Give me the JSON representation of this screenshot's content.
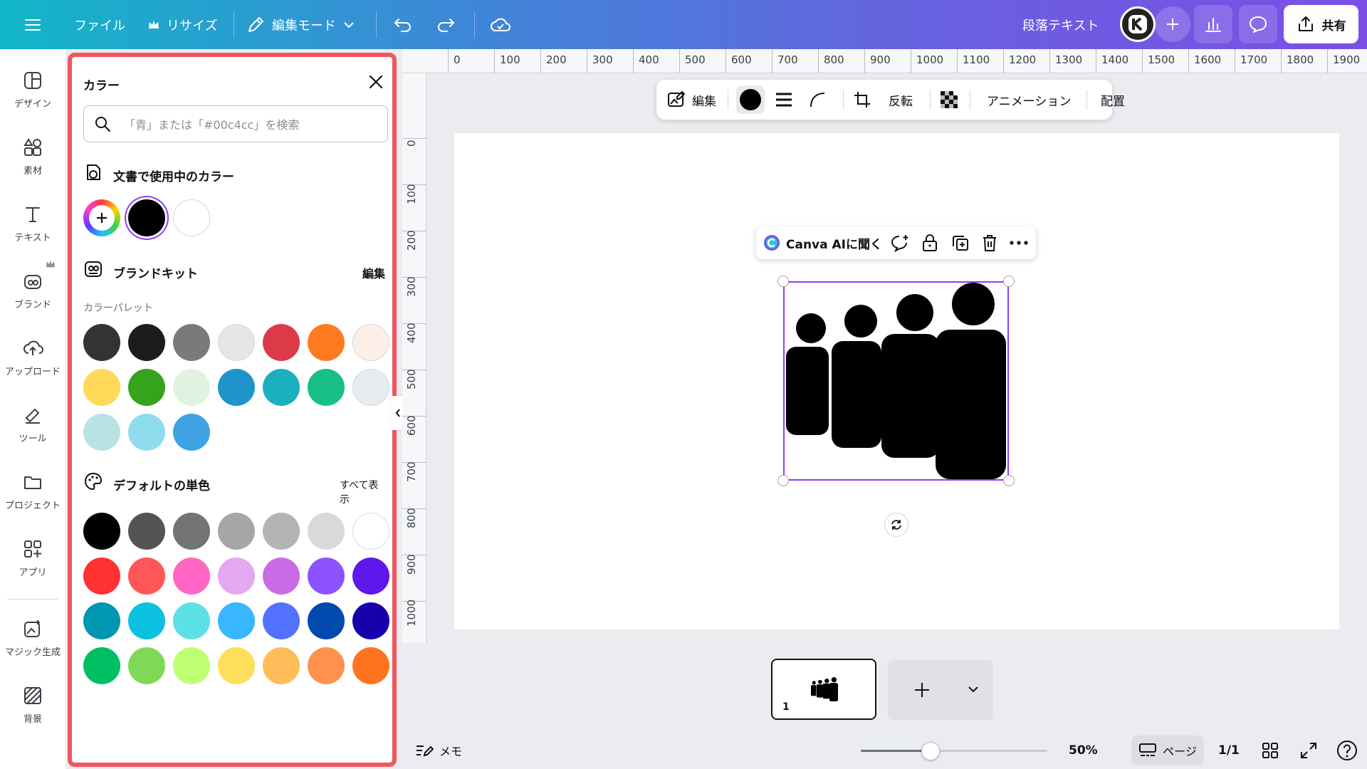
{
  "topbar": {
    "menu_icon": "hamburger-menu-icon",
    "file_label": "ファイル",
    "resize_label": "リサイズ",
    "edit_mode_label": "編集モード",
    "doc_title": "段落テキスト",
    "share_label": "共有"
  },
  "sidebar": {
    "items": [
      {
        "label": "デザイン",
        "icon": "design-icon"
      },
      {
        "label": "素材",
        "icon": "elements-icon"
      },
      {
        "label": "テキスト",
        "icon": "text-icon"
      },
      {
        "label": "ブランド",
        "icon": "brand-icon"
      },
      {
        "label": "アップロード",
        "icon": "upload-icon"
      },
      {
        "label": "ツール",
        "icon": "tools-icon"
      },
      {
        "label": "プロジェクト",
        "icon": "folder-icon"
      },
      {
        "label": "アプリ",
        "icon": "apps-icon"
      },
      {
        "label": "マジック生成",
        "icon": "magic-media-icon"
      },
      {
        "label": "背景",
        "icon": "background-icon"
      }
    ]
  },
  "color_panel": {
    "title": "カラー",
    "search_placeholder": "「青」または「#00c4cc」を検索",
    "doc_colors_title": "文書で使用中のカラー",
    "doc_colors": [
      "#000000",
      "#ffffff"
    ],
    "brand_kit_title": "ブランドキット",
    "brand_kit_edit": "編集",
    "palette_label": "カラーパレット",
    "palette": [
      "#333333",
      "#1c1c1c",
      "#7a7a7a",
      "#e6e6e6",
      "#db3b47",
      "#ff7a1f",
      "#fcefe8",
      "#ffd95a",
      "#36a31c",
      "#e1f3e0",
      "#1f94cc",
      "#1ab1bf",
      "#19c086",
      "#e6ecef",
      "#b9e3e3",
      "#8fdcec",
      "#3fa3e3"
    ],
    "default_title": "デフォルトの単色",
    "default_show_all": "すべて表示",
    "default_colors": [
      "#000000",
      "#545454",
      "#737373",
      "#a6a6a6",
      "#b4b4b4",
      "#d9d9d9",
      "#ffffff",
      "#ff3131",
      "#ff5757",
      "#ff66c4",
      "#e2a9f1",
      "#cb6ce6",
      "#8c52ff",
      "#5e17eb",
      "#0097b2",
      "#0cc0df",
      "#5ce1e6",
      "#38b6ff",
      "#5271ff",
      "#004aad",
      "#1800ad",
      "#00bf63",
      "#7ed957",
      "#c1ff72",
      "#ffde59",
      "#ffbd59",
      "#ff914d",
      "#ff751f"
    ]
  },
  "ruler": {
    "top": [
      "0",
      "100",
      "200",
      "300",
      "400",
      "500",
      "600",
      "700",
      "800",
      "900",
      "1000",
      "1100",
      "1200",
      "1300",
      "1400",
      "1500",
      "1600",
      "1700",
      "1800",
      "1900"
    ],
    "left": [
      "0",
      "100",
      "200",
      "300",
      "400",
      "500",
      "600",
      "700",
      "800",
      "900",
      "1000"
    ]
  },
  "floating_toolbar": {
    "edit_label": "編集",
    "flip_label": "反転",
    "animate_label": "アニメーション",
    "position_label": "配置"
  },
  "context_menu": {
    "ask_ai_label": "Canva AIに聞く"
  },
  "pages": {
    "thumb_number": "1",
    "notes_label": "メモ",
    "zoom": "50%",
    "zoom_fraction": 0.5,
    "page_label": "ページ",
    "page_count": "1/1"
  }
}
